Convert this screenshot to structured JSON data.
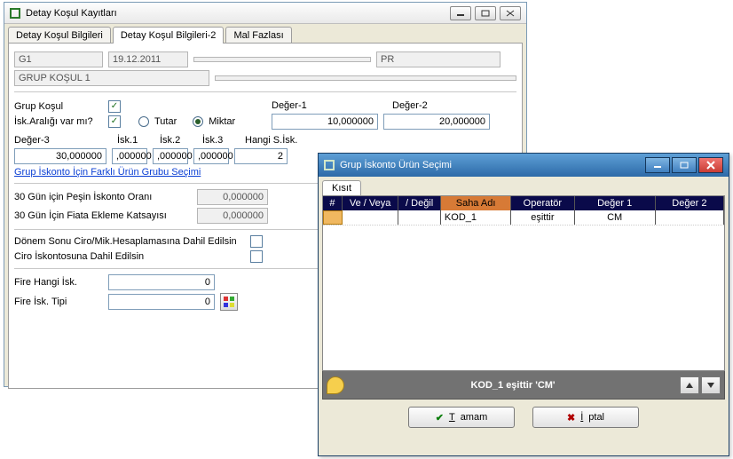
{
  "win1": {
    "title": "Detay Koşul Kayıtları",
    "tabs": [
      "Detay Koşul Bilgileri",
      "Detay Koşul Bilgileri-2",
      "Mal Fazlası"
    ],
    "activeTab": 1,
    "header": {
      "code": "G1",
      "date": "19.12.2011",
      "mid": "",
      "right": "PR",
      "desc": "GRUP KOŞUL 1"
    },
    "labels": {
      "grupKosul": "Grup Koşul",
      "iskAraligi": "İsk.Aralığı var mı?",
      "tutar": "Tutar",
      "miktar": "Miktar",
      "deger1": "Değer-1",
      "deger2": "Değer-2",
      "deger3": "Değer-3",
      "isk1": "İsk.1",
      "isk2": "İsk.2",
      "isk3": "İsk.3",
      "hangiSisk": "Hangi S.İsk.",
      "link": "Grup İskonto İçin Farklı Ürün Grubu Seçimi",
      "pesinOran": "30 Gün için Peşin İskonto Oranı",
      "fiataEkleme": "30 Gün İçin Fiata Ekleme Katsayısı",
      "donemSonu": "Dönem Sonu Ciro/Mik.Hesaplamasına Dahil Edilsin",
      "ciroIsk": "Ciro İskontosuna Dahil Edilsin",
      "fireHangi": "Fire Hangi İsk.",
      "fireTipi": "Fire İsk. Tipi"
    },
    "values": {
      "grupKosul": true,
      "iskAraligi": true,
      "radio": "miktar",
      "deger1": "10,000000",
      "deger2": "20,000000",
      "deger3": "30,000000",
      "isk1": ",000000",
      "isk2": ",000000",
      "isk3": ",000000",
      "hangiSisk": "2",
      "pesinOran": "0,000000",
      "fiataEkleme": "0,000000",
      "donemSonu": false,
      "ciroIsk": false,
      "fireHangi": "0",
      "fireTipi": "0"
    }
  },
  "win2": {
    "title": "Grup İskonto Ürün Seçimi",
    "tab": "Kısıt",
    "columns": {
      "hash": "#",
      "veveya": "Ve / Veya",
      "degil": "/ Değil",
      "saha": "Saha Adı",
      "op": "Operatör",
      "d1": "Değer 1",
      "d2": "Değer 2"
    },
    "row": {
      "hash": "",
      "veveya": "",
      "degil": "",
      "saha": "KOD_1",
      "op": "eşittir",
      "d1": "CM",
      "d2": ""
    },
    "status": "KOD_1 eşittir 'CM'",
    "buttons": {
      "ok": "Tamam",
      "cancel": "İptal"
    }
  }
}
